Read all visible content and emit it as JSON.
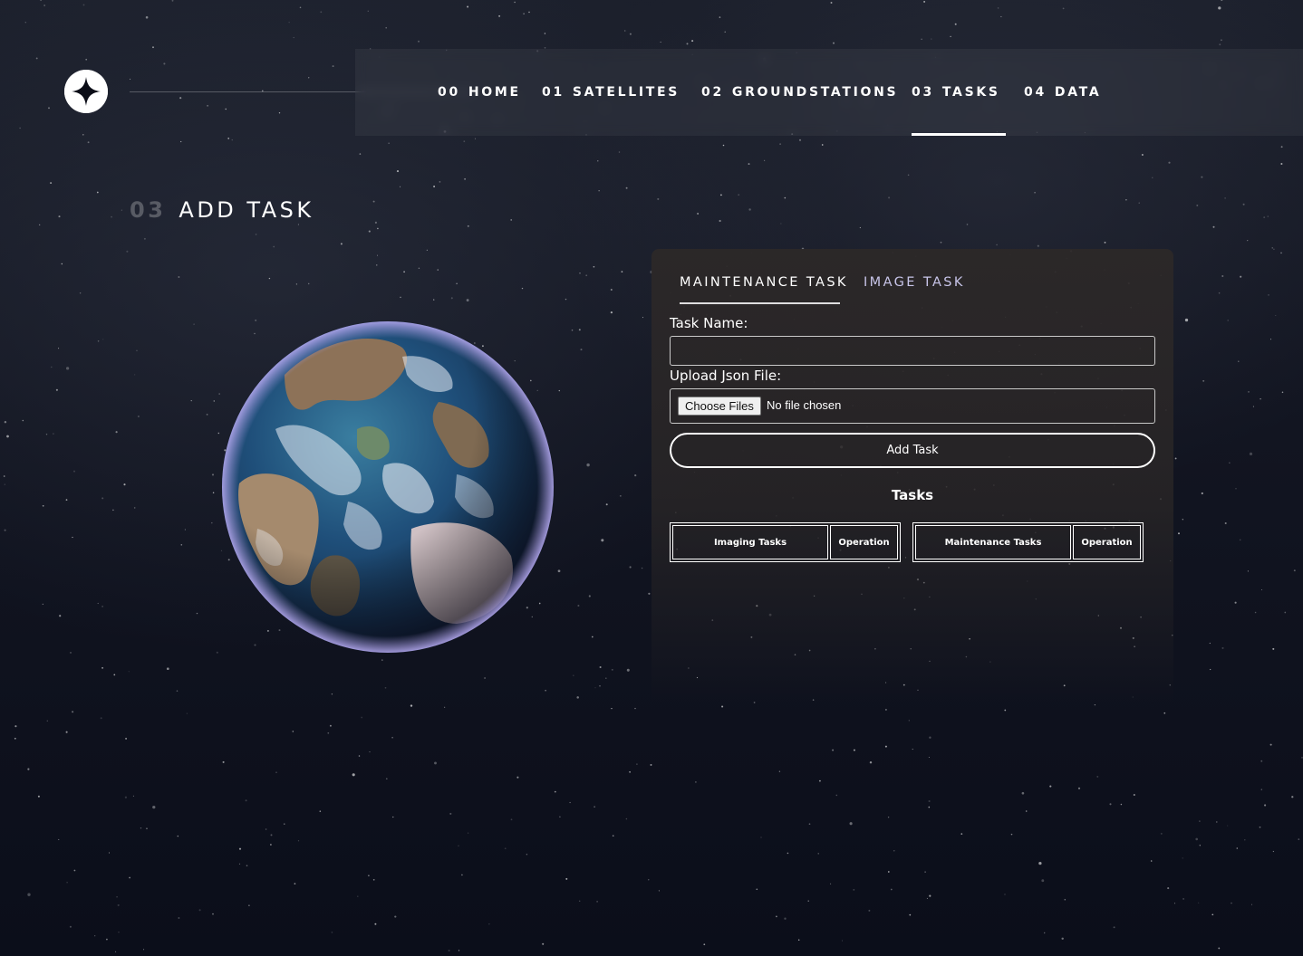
{
  "nav": {
    "items": [
      {
        "num": "00",
        "label": "HOME"
      },
      {
        "num": "01",
        "label": "SATELLITES"
      },
      {
        "num": "02",
        "label": "GROUNDSTATIONS"
      },
      {
        "num": "03",
        "label": "TASKS"
      },
      {
        "num": "04",
        "label": "DATA"
      }
    ],
    "active": "TASKS"
  },
  "page": {
    "num": "03",
    "title": "ADD TASK"
  },
  "form": {
    "tabs": [
      {
        "label": "MAINTENANCE TASK",
        "active": true
      },
      {
        "label": "IMAGE TASK",
        "active": false
      }
    ],
    "task_name_label": "Task Name:",
    "task_name_value": "",
    "upload_label": "Upload Json File:",
    "choose_files_label": "Choose Files",
    "file_status": "No file chosen",
    "submit_label": "Add Task"
  },
  "tasks": {
    "heading": "Tasks",
    "tables": [
      {
        "columns": [
          "Imaging Tasks",
          "Operation"
        ]
      },
      {
        "columns": [
          "Maintenance Tasks",
          "Operation"
        ]
      }
    ]
  },
  "colors": {
    "background": "#0b0d17",
    "panel": "#2b2727",
    "tab_inactive": "#c7c4e8",
    "accent": "#ffffff"
  },
  "icons": {
    "logo": "four-point-star-icon"
  }
}
